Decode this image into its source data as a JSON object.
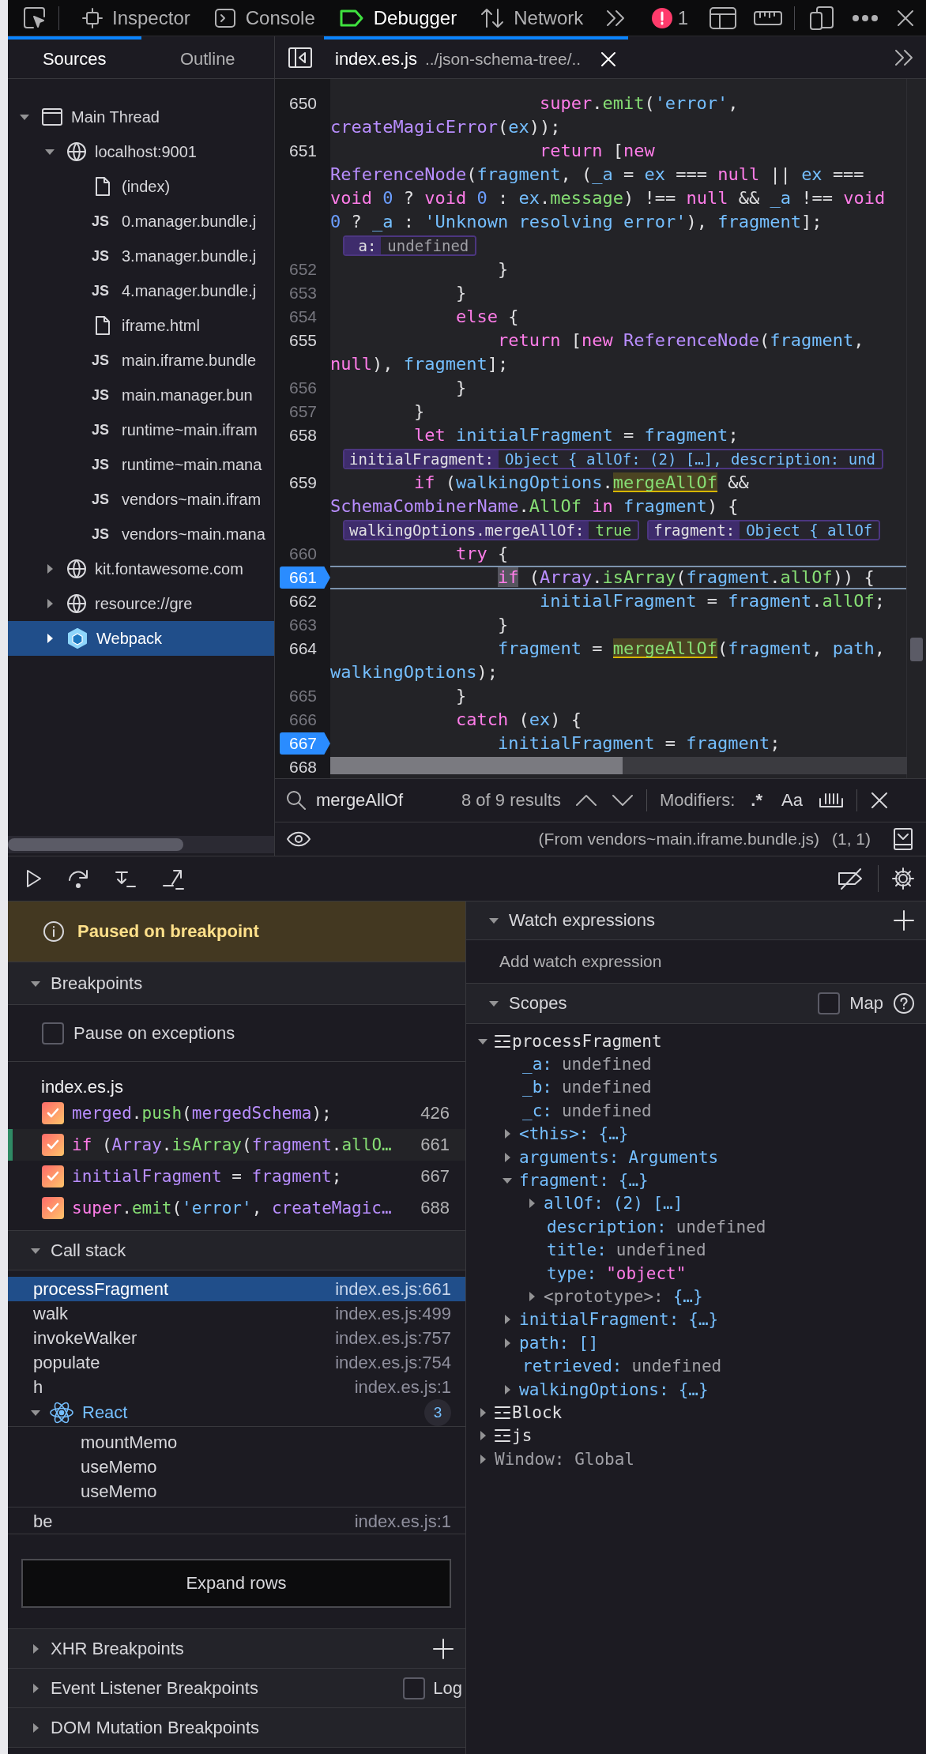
{
  "toolbar": {
    "tabs": [
      {
        "label": "Inspector",
        "kind": "inspector",
        "selected": false
      },
      {
        "label": "Console",
        "kind": "console",
        "selected": false
      },
      {
        "label": "Debugger",
        "kind": "debugger",
        "selected": true
      },
      {
        "label": "Network",
        "kind": "network",
        "selected": false
      }
    ],
    "error_count": "1"
  },
  "sidebar": {
    "tabs": [
      {
        "label": "Sources",
        "selected": true
      },
      {
        "label": "Outline",
        "selected": false
      }
    ],
    "tree": [
      {
        "label": "Main Thread",
        "kind": "thread",
        "expanded": true,
        "selected": false,
        "children": [
          {
            "label": "localhost:9001",
            "kind": "host",
            "expanded": true,
            "selected": false,
            "children": [
              {
                "label": "(index)",
                "kind": "file",
                "selected": false
              },
              {
                "label": "0.manager.bundle.j",
                "kind": "script",
                "badge": "JS",
                "selected": false
              },
              {
                "label": "3.manager.bundle.j",
                "kind": "script",
                "badge": "JS",
                "selected": false
              },
              {
                "label": "4.manager.bundle.j",
                "kind": "script",
                "badge": "JS",
                "selected": false
              },
              {
                "label": "iframe.html",
                "kind": "file",
                "selected": false
              },
              {
                "label": "main.iframe.bundle",
                "kind": "script",
                "badge": "JS",
                "selected": false
              },
              {
                "label": "main.manager.bun",
                "kind": "script",
                "badge": "JS",
                "selected": false
              },
              {
                "label": "runtime~main.ifram",
                "kind": "script",
                "badge": "JS",
                "selected": false
              },
              {
                "label": "runtime~main.mana",
                "kind": "script",
                "badge": "JS",
                "selected": false
              },
              {
                "label": "vendors~main.ifram",
                "kind": "script",
                "badge": "JS",
                "selected": false
              },
              {
                "label": "vendors~main.mana",
                "kind": "script",
                "badge": "JS",
                "selected": false
              }
            ]
          },
          {
            "label": "kit.fontawesome.com",
            "kind": "host",
            "expanded": false,
            "selected": false
          },
          {
            "label": "resource://gre",
            "kind": "host",
            "expanded": false,
            "selected": false
          },
          {
            "label": "Webpack",
            "kind": "bundler",
            "expanded": false,
            "selected": true
          }
        ]
      }
    ]
  },
  "editor": {
    "tab": {
      "filename": "index.es.js",
      "path": "../json-schema-tree/..",
      "selected": true
    },
    "lines": [
      {
        "kind": "code",
        "number": "650",
        "dimmed": false,
        "breakpoint": false,
        "paused": false,
        "tokens": [
          {
            "kind": "keyword",
            "text": "                    super"
          },
          {
            "kind": "plain",
            "text": "."
          },
          {
            "kind": "property",
            "text": "emit"
          },
          {
            "kind": "plain",
            "text": "("
          },
          {
            "kind": "string",
            "text": "'error'"
          },
          {
            "kind": "plain",
            "text": ", "
          },
          {
            "kind": "function",
            "text": "createMagicError"
          },
          {
            "kind": "plain",
            "text": "("
          },
          {
            "kind": "variable",
            "text": "ex"
          },
          {
            "kind": "plain",
            "text": "));"
          }
        ]
      },
      {
        "kind": "code",
        "number": "651",
        "dimmed": false,
        "breakpoint": false,
        "paused": false,
        "tokens": [
          {
            "kind": "keyword",
            "text": "                    return"
          },
          {
            "kind": "plain",
            "text": " ["
          },
          {
            "kind": "keyword",
            "text": "new"
          },
          {
            "kind": "function",
            "text": " ReferenceNode"
          },
          {
            "kind": "plain",
            "text": "("
          },
          {
            "kind": "variable",
            "text": "fragment"
          },
          {
            "kind": "plain",
            "text": ", ("
          },
          {
            "kind": "variable",
            "text": "_a"
          },
          {
            "kind": "plain",
            "text": " = "
          },
          {
            "kind": "variable",
            "text": "ex"
          },
          {
            "kind": "plain",
            "text": " === "
          },
          {
            "kind": "keyword",
            "text": "null"
          },
          {
            "kind": "plain",
            "text": " || "
          },
          {
            "kind": "variable",
            "text": "ex"
          },
          {
            "kind": "plain",
            "text": " === "
          },
          {
            "kind": "keyword",
            "text": "void"
          },
          {
            "kind": "number",
            "text": " 0"
          },
          {
            "kind": "plain",
            "text": " ? "
          },
          {
            "kind": "keyword",
            "text": "void"
          },
          {
            "kind": "number",
            "text": " 0"
          },
          {
            "kind": "plain",
            "text": " : "
          },
          {
            "kind": "variable",
            "text": "ex"
          },
          {
            "kind": "plain",
            "text": "."
          },
          {
            "kind": "property",
            "text": "message"
          },
          {
            "kind": "plain",
            "text": ") !== "
          },
          {
            "kind": "keyword",
            "text": "null"
          },
          {
            "kind": "plain",
            "text": " && "
          },
          {
            "kind": "variable",
            "text": "_a"
          },
          {
            "kind": "plain",
            "text": " !== "
          },
          {
            "kind": "keyword",
            "text": "void"
          },
          {
            "kind": "number",
            "text": " 0"
          },
          {
            "kind": "plain",
            "text": " ? "
          },
          {
            "kind": "variable",
            "text": "_a"
          },
          {
            "kind": "plain",
            "text": " : "
          },
          {
            "kind": "string",
            "text": "'Unknown resolving error'"
          },
          {
            "kind": "plain",
            "text": "), "
          },
          {
            "kind": "variable",
            "text": "fragment"
          },
          {
            "kind": "plain",
            "text": "];"
          }
        ]
      },
      {
        "kind": "preview",
        "previews": [
          {
            "name": "_a:",
            "value": "undefined",
            "kind": "undefined"
          }
        ]
      },
      {
        "kind": "code",
        "number": "652",
        "dimmed": true,
        "breakpoint": false,
        "paused": false,
        "tokens": [
          {
            "kind": "plain",
            "text": "                }"
          }
        ]
      },
      {
        "kind": "code",
        "number": "653",
        "dimmed": true,
        "breakpoint": false,
        "paused": false,
        "tokens": [
          {
            "kind": "plain",
            "text": "            }"
          }
        ]
      },
      {
        "kind": "code",
        "number": "654",
        "dimmed": true,
        "breakpoint": false,
        "paused": false,
        "tokens": [
          {
            "kind": "keyword",
            "text": "            else"
          },
          {
            "kind": "plain",
            "text": " {"
          }
        ]
      },
      {
        "kind": "code",
        "number": "655",
        "dimmed": false,
        "breakpoint": false,
        "paused": false,
        "tokens": [
          {
            "kind": "keyword",
            "text": "                return"
          },
          {
            "kind": "plain",
            "text": " ["
          },
          {
            "kind": "keyword",
            "text": "new"
          },
          {
            "kind": "function",
            "text": " ReferenceNode"
          },
          {
            "kind": "plain",
            "text": "("
          },
          {
            "kind": "variable",
            "text": "fragment"
          },
          {
            "kind": "plain",
            "text": ", "
          },
          {
            "kind": "keyword",
            "text": "null"
          },
          {
            "kind": "plain",
            "text": "), "
          },
          {
            "kind": "variable",
            "text": "fragment"
          },
          {
            "kind": "plain",
            "text": "];"
          }
        ]
      },
      {
        "kind": "code",
        "number": "656",
        "dimmed": true,
        "breakpoint": false,
        "paused": false,
        "tokens": [
          {
            "kind": "plain",
            "text": "            }"
          }
        ]
      },
      {
        "kind": "code",
        "number": "657",
        "dimmed": true,
        "breakpoint": false,
        "paused": false,
        "tokens": [
          {
            "kind": "plain",
            "text": "        }"
          }
        ]
      },
      {
        "kind": "code",
        "number": "658",
        "dimmed": false,
        "breakpoint": false,
        "paused": false,
        "tokens": [
          {
            "kind": "keyword",
            "text": "        let"
          },
          {
            "kind": "variable",
            "text": " initialFragment"
          },
          {
            "kind": "plain",
            "text": " = "
          },
          {
            "kind": "variable",
            "text": "fragment"
          },
          {
            "kind": "plain",
            "text": ";"
          }
        ]
      },
      {
        "kind": "preview",
        "previews": [
          {
            "name": "initialFragment:",
            "value": "Object { allOf: (2) […], description: und",
            "kind": "object"
          }
        ]
      },
      {
        "kind": "code",
        "number": "659",
        "dimmed": false,
        "breakpoint": false,
        "paused": false,
        "tokens": [
          {
            "kind": "keyword",
            "text": "        if"
          },
          {
            "kind": "plain",
            "text": " ("
          },
          {
            "kind": "variable",
            "text": "walkingOptions"
          },
          {
            "kind": "plain",
            "text": "."
          },
          {
            "kind": "match",
            "text": "mergeAllOf"
          },
          {
            "kind": "plain",
            "text": " && "
          },
          {
            "kind": "function",
            "text": "SchemaCombinerName"
          },
          {
            "kind": "plain",
            "text": "."
          },
          {
            "kind": "property",
            "text": "AllOf"
          },
          {
            "kind": "keyword",
            "text": " in"
          },
          {
            "kind": "variable",
            "text": " fragment"
          },
          {
            "kind": "plain",
            "text": ") {"
          }
        ]
      },
      {
        "kind": "preview",
        "previews": [
          {
            "name": "walkingOptions.mergeAllOf:",
            "value": "true",
            "kind": "boolean"
          },
          {
            "name": "fragment:",
            "value": "Object { allOf",
            "kind": "object"
          }
        ]
      },
      {
        "kind": "code",
        "number": "660",
        "dimmed": true,
        "breakpoint": false,
        "paused": false,
        "tokens": [
          {
            "kind": "keyword",
            "text": "            try"
          },
          {
            "kind": "plain",
            "text": " {"
          }
        ]
      },
      {
        "kind": "code",
        "number": "661",
        "dimmed": false,
        "breakpoint": true,
        "paused": true,
        "tokens": [
          {
            "kind": "current",
            "text": "                if"
          },
          {
            "kind": "plain",
            "text": " ("
          },
          {
            "kind": "function",
            "text": "Array"
          },
          {
            "kind": "plain",
            "text": "."
          },
          {
            "kind": "property",
            "text": "isArray"
          },
          {
            "kind": "plain",
            "text": "("
          },
          {
            "kind": "variable",
            "text": "fragment"
          },
          {
            "kind": "plain",
            "text": "."
          },
          {
            "kind": "property",
            "text": "allOf"
          },
          {
            "kind": "plain",
            "text": ")) {"
          }
        ]
      },
      {
        "kind": "code",
        "number": "662",
        "dimmed": false,
        "breakpoint": false,
        "paused": false,
        "tokens": [
          {
            "kind": "variable",
            "text": "                    initialFragment"
          },
          {
            "kind": "plain",
            "text": " = "
          },
          {
            "kind": "variable",
            "text": "fragment"
          },
          {
            "kind": "plain",
            "text": "."
          },
          {
            "kind": "property",
            "text": "allOf"
          },
          {
            "kind": "plain",
            "text": ";"
          }
        ]
      },
      {
        "kind": "code",
        "number": "663",
        "dimmed": true,
        "breakpoint": false,
        "paused": false,
        "tokens": [
          {
            "kind": "plain",
            "text": "                }"
          }
        ]
      },
      {
        "kind": "code",
        "number": "664",
        "dimmed": false,
        "breakpoint": false,
        "paused": false,
        "tokens": [
          {
            "kind": "variable",
            "text": "                fragment"
          },
          {
            "kind": "plain",
            "text": " = "
          },
          {
            "kind": "match",
            "text": "mergeAllOf"
          },
          {
            "kind": "plain",
            "text": "("
          },
          {
            "kind": "variable",
            "text": "fragment"
          },
          {
            "kind": "plain",
            "text": ", "
          },
          {
            "kind": "variable",
            "text": "path"
          },
          {
            "kind": "plain",
            "text": ", "
          },
          {
            "kind": "variable",
            "text": "walkingOptions"
          },
          {
            "kind": "plain",
            "text": ");"
          }
        ]
      },
      {
        "kind": "code",
        "number": "665",
        "dimmed": true,
        "breakpoint": false,
        "paused": false,
        "tokens": [
          {
            "kind": "plain",
            "text": "            }"
          }
        ]
      },
      {
        "kind": "code",
        "number": "666",
        "dimmed": true,
        "breakpoint": false,
        "paused": false,
        "tokens": [
          {
            "kind": "keyword",
            "text": "            catch"
          },
          {
            "kind": "plain",
            "text": " ("
          },
          {
            "kind": "variable",
            "text": "ex"
          },
          {
            "kind": "plain",
            "text": ") {"
          }
        ]
      },
      {
        "kind": "code",
        "number": "667",
        "dimmed": false,
        "breakpoint": true,
        "paused": false,
        "tokens": [
          {
            "kind": "variable",
            "text": "                initialFragment"
          },
          {
            "kind": "plain",
            "text": " = "
          },
          {
            "kind": "variable",
            "text": "fragment"
          },
          {
            "kind": "plain",
            "text": ";"
          }
        ]
      },
      {
        "kind": "code",
        "number": "668",
        "dimmed": false,
        "breakpoint": false,
        "paused": false
      }
    ]
  },
  "search": {
    "value": "mergeAllOf",
    "results": "8 of 9 results",
    "modifiers_label": "Modifiers:",
    "regex_label": ".*",
    "case_label": "Aa"
  },
  "status": {
    "source": "(From vendors~main.iframe.bundle.js)",
    "position": "(1, 1)"
  },
  "paused_banner": "Paused on breakpoint",
  "breakpoints": {
    "title": "Breakpoints",
    "expanded": true,
    "pause_on_exceptions": {
      "label": "Pause on exceptions",
      "checked": false
    },
    "file": "index.es.js",
    "items": [
      {
        "line": "426",
        "checked": true,
        "current": false,
        "tokens": [
          {
            "kind": "name",
            "text": "merged"
          },
          {
            "kind": "plain",
            "text": "."
          },
          {
            "kind": "property",
            "text": "push"
          },
          {
            "kind": "plain",
            "text": "("
          },
          {
            "kind": "name",
            "text": "mergedSchema"
          },
          {
            "kind": "plain",
            "text": ");"
          }
        ]
      },
      {
        "line": "661",
        "checked": true,
        "current": true,
        "tokens": [
          {
            "kind": "keyword",
            "text": "if"
          },
          {
            "kind": "plain",
            "text": " ("
          },
          {
            "kind": "name",
            "text": "Array"
          },
          {
            "kind": "plain",
            "text": "."
          },
          {
            "kind": "property",
            "text": "isArray"
          },
          {
            "kind": "plain",
            "text": "("
          },
          {
            "kind": "name",
            "text": "fragment"
          },
          {
            "kind": "plain",
            "text": "."
          },
          {
            "kind": "property",
            "text": "allO…"
          }
        ]
      },
      {
        "line": "667",
        "checked": true,
        "current": false,
        "tokens": [
          {
            "kind": "name",
            "text": "initialFragment"
          },
          {
            "kind": "plain",
            "text": " = "
          },
          {
            "kind": "name",
            "text": "fragment"
          },
          {
            "kind": "plain",
            "text": ";"
          }
        ]
      },
      {
        "line": "688",
        "checked": true,
        "current": false,
        "tokens": [
          {
            "kind": "keyword",
            "text": "super"
          },
          {
            "kind": "plain",
            "text": "."
          },
          {
            "kind": "property",
            "text": "emit"
          },
          {
            "kind": "plain",
            "text": "("
          },
          {
            "kind": "string",
            "text": "'error'"
          },
          {
            "kind": "plain",
            "text": ", "
          },
          {
            "kind": "name",
            "text": "createMagic…"
          }
        ]
      }
    ]
  },
  "call_stack": {
    "title": "Call stack",
    "expanded": true,
    "frames": [
      {
        "kind": "frame",
        "name": "processFragment",
        "location": "index.es.js:661",
        "selected": true
      },
      {
        "kind": "frame",
        "name": "walk",
        "location": "index.es.js:499",
        "selected": false
      },
      {
        "kind": "frame",
        "name": "invokeWalker",
        "location": "index.es.js:757",
        "selected": false
      },
      {
        "kind": "frame",
        "name": "populate",
        "location": "index.es.js:754",
        "selected": false
      },
      {
        "kind": "frame",
        "name": "h",
        "location": "index.es.js:1",
        "selected": false
      },
      {
        "kind": "group",
        "name": "React",
        "count": "3",
        "expanded": true,
        "selected": false,
        "children": [
          {
            "name": "mountMemo",
            "selected": false
          },
          {
            "name": "useMemo",
            "selected": false
          },
          {
            "name": "useMemo",
            "selected": false
          }
        ]
      },
      {
        "kind": "frame",
        "name": "be",
        "location": "index.es.js:1",
        "selected": false
      }
    ],
    "expand_label": "Expand rows"
  },
  "collapsed_sections": [
    {
      "title": "XHR Breakpoints",
      "expanded": false,
      "kind": "add"
    },
    {
      "title": "Event Listener Breakpoints",
      "expanded": false,
      "kind": "log",
      "log_label": "Log",
      "log_checked": false
    },
    {
      "title": "DOM Mutation Breakpoints",
      "expanded": false,
      "kind": "plain"
    }
  ],
  "watch": {
    "title": "Watch expressions",
    "expanded": true,
    "placeholder": "Add watch expression"
  },
  "scopes": {
    "title": "Scopes",
    "expanded": true,
    "map_label": "Map",
    "map_checked": false,
    "tree": [
      {
        "name": "processFragment",
        "kind": "scope",
        "expanded": true,
        "children": [
          {
            "name": "_a:",
            "kind": "property",
            "value": {
              "text": "undefined",
              "kind": "undefined"
            }
          },
          {
            "name": "_b:",
            "kind": "property",
            "value": {
              "text": "undefined",
              "kind": "undefined"
            }
          },
          {
            "name": "_c:",
            "kind": "property",
            "value": {
              "text": "undefined",
              "kind": "undefined"
            }
          },
          {
            "name": "<this>:",
            "kind": "property",
            "value": {
              "text": "{…}",
              "kind": "object"
            },
            "expanded": false
          },
          {
            "name": "arguments:",
            "kind": "property",
            "value": {
              "text": "Arguments",
              "kind": "object"
            },
            "expanded": false
          },
          {
            "name": "fragment:",
            "kind": "property",
            "value": {
              "text": "{…}",
              "kind": "object"
            },
            "expanded": true,
            "children": [
              {
                "name": "allOf:",
                "kind": "property",
                "value": {
                  "text": "(2) […]",
                  "kind": "array"
                },
                "expanded": false
              },
              {
                "name": "description:",
                "kind": "property",
                "value": {
                  "text": "undefined",
                  "kind": "undefined"
                }
              },
              {
                "name": "title:",
                "kind": "property",
                "value": {
                  "text": "undefined",
                  "kind": "undefined"
                }
              },
              {
                "name": "type:",
                "kind": "property",
                "value": {
                  "text": "\"object\"",
                  "kind": "string"
                }
              },
              {
                "name": "<prototype>:",
                "kind": "prototype",
                "value": {
                  "text": "{…}",
                  "kind": "object"
                },
                "expanded": false
              }
            ]
          },
          {
            "name": "initialFragment:",
            "kind": "property",
            "value": {
              "text": "{…}",
              "kind": "object"
            },
            "expanded": false
          },
          {
            "name": "path:",
            "kind": "property",
            "value": {
              "text": "[]",
              "kind": "object"
            },
            "expanded": false
          },
          {
            "name": "retrieved:",
            "kind": "property",
            "value": {
              "text": "undefined",
              "kind": "undefined"
            }
          },
          {
            "name": "walkingOptions:",
            "kind": "property",
            "value": {
              "text": "{…}",
              "kind": "object"
            },
            "expanded": false
          }
        ]
      },
      {
        "name": "Block",
        "kind": "scope",
        "expanded": false
      },
      {
        "name": "js",
        "kind": "scope",
        "expanded": false
      },
      {
        "name": "Window: Global",
        "kind": "global",
        "expanded": false
      }
    ]
  }
}
